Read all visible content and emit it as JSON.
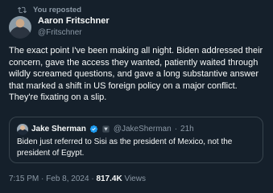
{
  "repost": {
    "label": "You reposted",
    "icon": "repost-icon"
  },
  "author": {
    "name": "Aaron Fritschner",
    "handle": "@Fritschner"
  },
  "tweet": {
    "text": "The exact point I've been making all night. Biden addressed their concern, gave the access they wanted, patiently waited through wildly screamed questions, and gave a long substantive answer that marked a shift in US foreign policy on a major conflict. They're fixating on a slip."
  },
  "quote": {
    "name": "Jake Sherman",
    "handle": "@JakeSherman",
    "separator": "·",
    "time": "21h",
    "text": "Biden just referred to Sisi as the president of Mexico, not the president of Egypt.",
    "badges": [
      "verified-icon",
      "affiliate-badge-icon"
    ]
  },
  "meta": {
    "time": "7:15 PM",
    "separator": "·",
    "date": "Feb 8, 2024",
    "separator2": "·",
    "views_count": "817.4K",
    "views_label": "Views"
  },
  "colors": {
    "background": "#15202b",
    "text": "#f7f9f9",
    "secondary": "#8b98a5",
    "border": "#38444d",
    "verified": "#1d9bf0"
  }
}
